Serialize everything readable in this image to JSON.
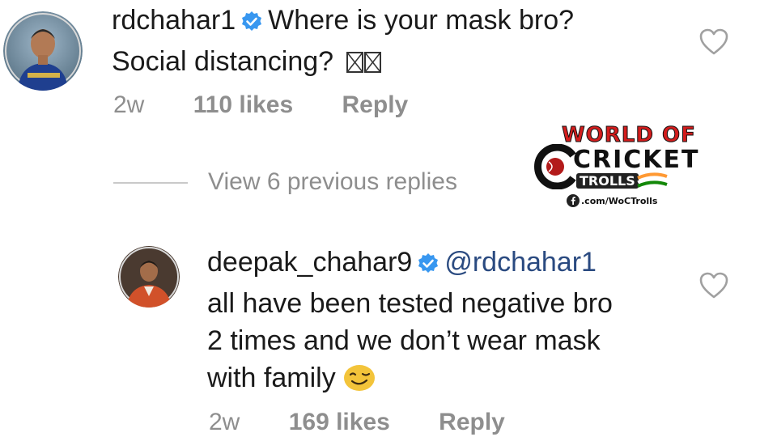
{
  "comment1": {
    "username": "rdchahar1",
    "text_line1": "Where is your mask bro?",
    "text_line2": "Social distancing?",
    "time": "2w",
    "likes": "110 likes",
    "reply": "Reply"
  },
  "view_replies": "View 6 previous replies",
  "comment2": {
    "username": "deepak_chahar9",
    "mention": "@rdchahar1",
    "line1": "all have been tested negative bro",
    "line2": "2 times and we don’t wear mask",
    "line3": "with family",
    "time": "2w",
    "likes": "169 likes",
    "reply": "Reply"
  },
  "watermark": {
    "top": "WORLD OF",
    "mid": "CRICKET",
    "bottom": "TROLLS",
    "url": ".com/WoCTrolls"
  },
  "icons": {
    "verified": "verified-badge-icon",
    "heart": "heart-outline-icon",
    "emoji": "winking-face-icon"
  },
  "colors": {
    "verified_blue": "#3897f0",
    "meta_gray": "#8e8e8e",
    "watermark_red": "#d31d1d"
  }
}
